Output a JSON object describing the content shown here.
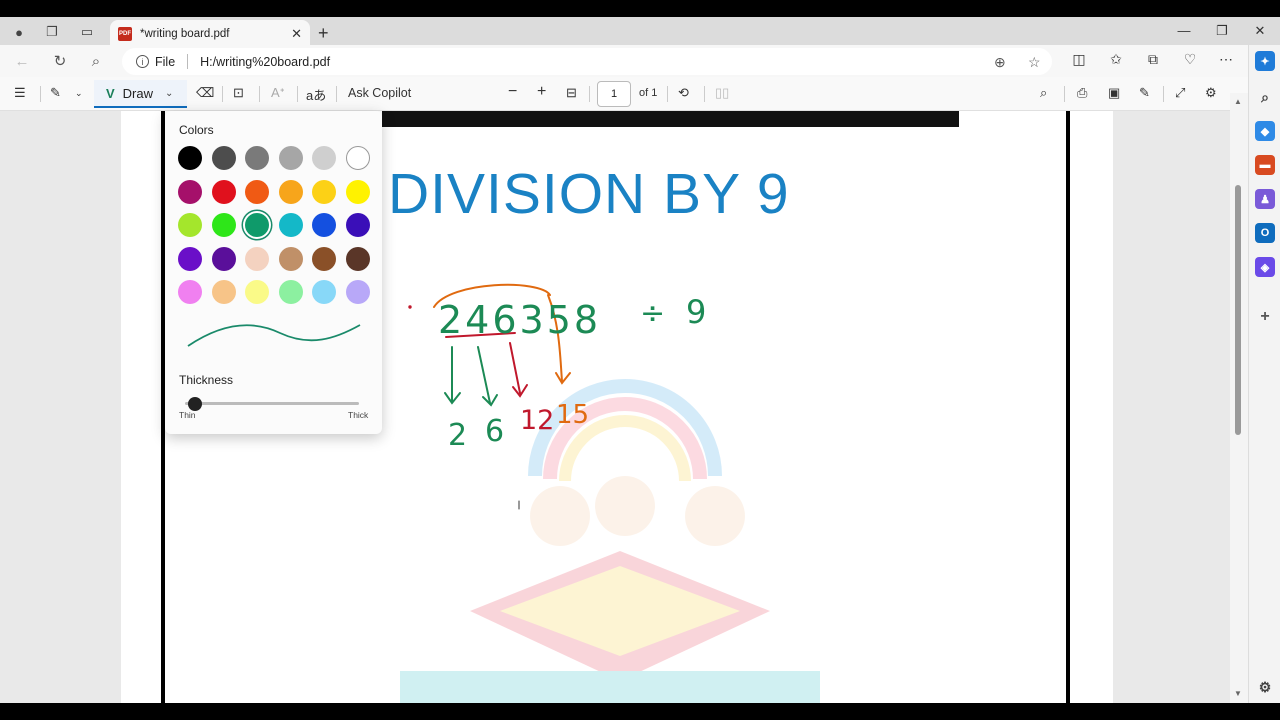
{
  "browser": {
    "tab_title": "*writing board.pdf",
    "pdf_badge": "PDF",
    "tab_close": "✕",
    "new_tab": "+",
    "address_prefix": "File",
    "address_url": "H:/writing%20board.pdf"
  },
  "pdf_toolbar": {
    "draw_label": "Draw",
    "ask_copilot": "Ask Copilot",
    "page_number": "1",
    "page_total": "of 1"
  },
  "document": {
    "title": "DIVISION BY 9",
    "handwriting": {
      "number": "246358",
      "divide": "÷",
      "divisor": "9",
      "results": [
        "2",
        "6",
        "12",
        "15"
      ],
      "result_colors": [
        "#1c8a55",
        "#1c8a55",
        "#c0182c",
        "#e06a10"
      ]
    }
  },
  "color_popup": {
    "colors_label": "Colors",
    "thickness_label": "Thickness",
    "thin_label": "Thin",
    "thick_label": "Thick",
    "thickness_value": 0.02,
    "selected_color": "#0f9a6a",
    "swatches": [
      [
        "#000000",
        "#4d4d4d",
        "#7a7a7a",
        "#a6a6a6",
        "#cfcfcf",
        "#ffffff"
      ],
      [
        "#a5106a",
        "#e0111d",
        "#f05a14",
        "#f7a51b",
        "#fcd116",
        "#fff200"
      ],
      [
        "#a4e62c",
        "#2ee619",
        "#0f9a6a",
        "#14b8c8",
        "#1450e0",
        "#3a0fb8"
      ],
      [
        "#6a0fc8",
        "#5a0f9a",
        "#f4d2c0",
        "#c09068",
        "#8a5028",
        "#5a3628"
      ],
      [
        "#f080f0",
        "#f7c488",
        "#fafa88",
        "#8cf0a0",
        "#88d8f8",
        "#b8a8f8"
      ]
    ]
  }
}
